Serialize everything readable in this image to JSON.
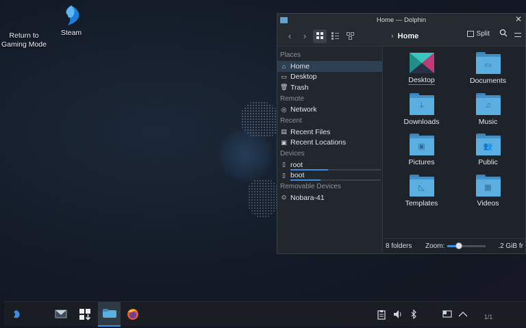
{
  "desktop": {
    "icons": [
      {
        "label": "Return to Gaming Mode",
        "icon": "return-gaming-mode-icon"
      },
      {
        "label": "Steam",
        "icon": "steam-icon"
      }
    ]
  },
  "window": {
    "title": "Home — Dolphin",
    "toolbar": {
      "back": "‹",
      "forward": "›",
      "breadcrumb": "Home",
      "split_label": "Split"
    },
    "sidebar": {
      "sections": [
        {
          "title": "Places",
          "items": [
            {
              "label": "Home",
              "icon": "home-icon",
              "selected": true
            },
            {
              "label": "Desktop",
              "icon": "desktop-icon"
            },
            {
              "label": "Trash",
              "icon": "trash-icon"
            }
          ]
        },
        {
          "title": "Remote",
          "items": [
            {
              "label": "Network",
              "icon": "network-icon"
            }
          ]
        },
        {
          "title": "Recent",
          "items": [
            {
              "label": "Recent Files",
              "icon": "recent-files-icon"
            },
            {
              "label": "Recent Locations",
              "icon": "recent-locations-icon"
            }
          ]
        },
        {
          "title": "Devices",
          "items": [
            {
              "label": "root",
              "icon": "drive-icon",
              "usage": 0.42
            },
            {
              "label": "boot",
              "icon": "drive-icon",
              "usage": 0.33
            }
          ]
        },
        {
          "title": "Removable Devices",
          "items": [
            {
              "label": "Nobara-41",
              "icon": "removable-drive-icon"
            }
          ]
        }
      ]
    },
    "folders": [
      {
        "label": "Desktop",
        "glyph": ""
      },
      {
        "label": "Documents",
        "glyph": "▭"
      },
      {
        "label": "Downloads",
        "glyph": "⤓"
      },
      {
        "label": "Music",
        "glyph": "♫"
      },
      {
        "label": "Pictures",
        "glyph": "▣"
      },
      {
        "label": "Public",
        "glyph": "👥"
      },
      {
        "label": "Templates",
        "glyph": "◺"
      },
      {
        "label": "Videos",
        "glyph": "▦"
      }
    ],
    "status": {
      "count": "8 folders",
      "zoom_label": "Zoom:",
      "zoom_level": 0.3,
      "free_space": ".2 GiB fr"
    }
  },
  "taskbar": {
    "clock": "1/1"
  },
  "colors": {
    "accent": "#3d8ee0",
    "folder": "#5aaee0"
  }
}
